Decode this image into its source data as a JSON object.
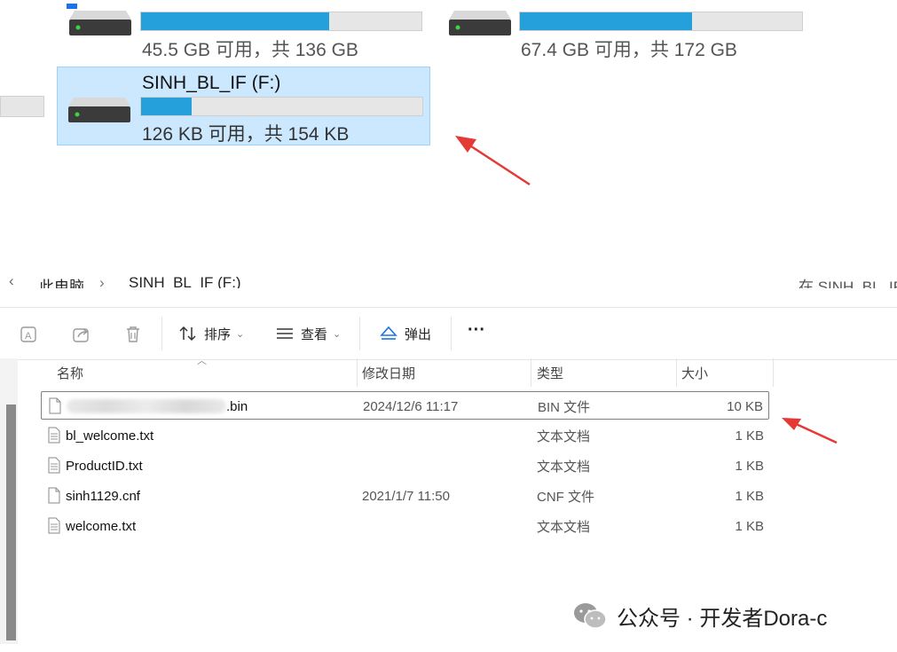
{
  "drives": [
    {
      "name": "",
      "info": "45.5 GB 可用，共 136 GB",
      "used_fraction": 0.67,
      "selected": false
    },
    {
      "name": "",
      "info": "67.4 GB 可用，共 172 GB",
      "used_fraction": 0.61,
      "selected": false
    },
    {
      "name": "SINH_BL_IF (F:)",
      "info": "126 KB 可用，共 154 KB",
      "used_fraction": 0.18,
      "selected": true
    }
  ],
  "breadcrumb": {
    "left": "此电脑",
    "sep": "›",
    "current": "SINH_BL_IF (F:)",
    "search": "在 SINH_BL_IF"
  },
  "toolbar": {
    "sort_label": "排序",
    "view_label": "查看",
    "eject_label": "弹出",
    "more_label": "···"
  },
  "columns": {
    "name": "名称",
    "date": "修改日期",
    "type": "类型",
    "size": "大小"
  },
  "files": [
    {
      "name_visible": ".bin",
      "date": "2024/12/6 11:17",
      "type": "BIN 文件",
      "size": "10 KB"
    },
    {
      "name": "bl_welcome.txt",
      "date": "",
      "type": "文本文档",
      "size": "1 KB"
    },
    {
      "name": "ProductID.txt",
      "date": "",
      "type": "文本文档",
      "size": "1 KB"
    },
    {
      "name": "sinh1129.cnf",
      "date": "2021/1/7 11:50",
      "type": "CNF 文件",
      "size": "1 KB"
    },
    {
      "name": "welcome.txt",
      "date": "",
      "type": "文本文档",
      "size": "1 KB"
    }
  ],
  "watermark": "公众号 · 开发者Dora-c",
  "colors": {
    "accent": "#26a0da",
    "selection_bg": "#cce8ff",
    "arrow": "#e53935"
  }
}
